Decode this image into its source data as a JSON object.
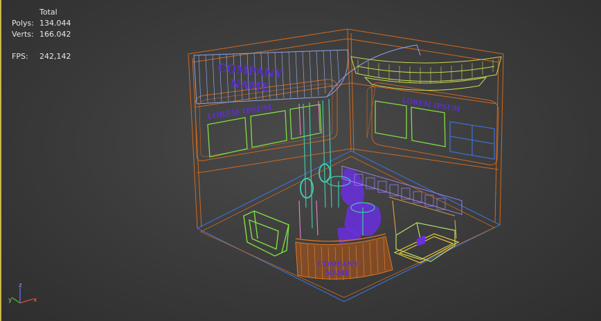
{
  "viewport": {
    "stats": {
      "header": "Total",
      "polys_label": "Polys:",
      "polys_value": "134.044",
      "verts_label": "Verts:",
      "verts_value": "166.042",
      "fps_label": "FPS:",
      "fps_value": "242,142"
    },
    "scene": {
      "header_sign_line1": "COMPANY",
      "header_sign_line2": "NAME",
      "left_wall_text": "LOREM IPSUM",
      "right_wall_text": "LOREM IPSUM",
      "counter_line1": "COMPANY",
      "counter_line2": "NAME"
    },
    "gizmo": {
      "x_label": "x",
      "y_label": "y",
      "z_label": "z"
    },
    "colors": {
      "frame": "#d2691e",
      "glass": "#6f8fd8",
      "signage": "#5a2fd0",
      "screens": "#7fe040",
      "chandelier": "#c8dc50",
      "counter": "#e07820",
      "poles": "#40c8b0"
    }
  }
}
